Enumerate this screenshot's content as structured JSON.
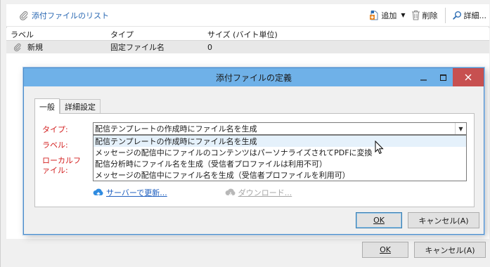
{
  "background": {
    "list_title": "添付ファイルのリスト",
    "toolbar": {
      "add_label": "追加",
      "delete_label": "削除",
      "detail_label": "詳細..."
    },
    "columns": [
      "ラベル",
      "タイプ",
      "サイズ (バイト単位)"
    ],
    "rows": [
      {
        "label": "新規",
        "type": "固定ファイル名",
        "size": "0"
      }
    ],
    "ok_label": "OK",
    "cancel_label": "キャンセル(A)"
  },
  "dialog": {
    "title": "添付ファイルの定義",
    "tabs": [
      "一般",
      "詳細設定"
    ],
    "type_label": "タイプ:",
    "label_label": "ラベル:",
    "local_file_label_1": "ローカルフ",
    "local_file_label_2": "ァイル:",
    "type_selected": "配信テンプレートの作成時にファイル名を生成",
    "type_options": [
      "配信テンプレートの作成時にファイル名を生成",
      "メッセージの配信中にファイルのコンテンツはパーソナライズされてPDFに変換",
      "配信分析時にファイル名を生成（受信者プロファイルは利用不可）",
      "メッセージの配信中にファイル名を生成（受信者プロファイルを利用可）"
    ],
    "update_link": "サーバーで更新...",
    "download_link": "ダウンロード...",
    "ok_label": "OK",
    "cancel_label": "キャンセル(A)"
  },
  "colors": {
    "titlebar": "#6fb1e8",
    "close_button": "#c75050",
    "required_label": "#d31f1f",
    "link": "#1f5fbf"
  }
}
